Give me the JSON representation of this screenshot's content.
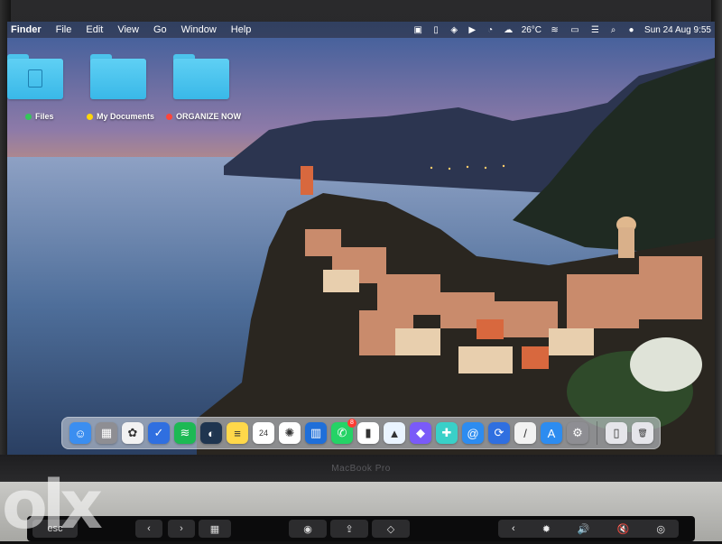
{
  "menubar": {
    "apple_icon": "apple-icon",
    "app_name": "Finder",
    "items": [
      "File",
      "Edit",
      "View",
      "Go",
      "Window",
      "Help"
    ],
    "status": {
      "weather": "26°C",
      "datetime": "Sun 24 Aug  9:55"
    }
  },
  "desktop": {
    "folders": [
      {
        "label": "Files",
        "tag_color": "#34c759",
        "icon": "folder-icon"
      },
      {
        "label": "My Documents",
        "tag_color": "#ffd60a",
        "icon": "folder-icon"
      },
      {
        "label": "ORGANIZE NOW",
        "tag_color": "#ff453a",
        "icon": "folder-icon"
      }
    ]
  },
  "dock": {
    "apps": [
      {
        "name": "finder-icon",
        "glyph": "☺",
        "color": "#3b8ef0"
      },
      {
        "name": "launchpad-icon",
        "glyph": "▦",
        "color": "#8e8e93"
      },
      {
        "name": "photos-icon",
        "glyph": "✿",
        "color": "#f2f2f2"
      },
      {
        "name": "reminders-icon",
        "glyph": "✓",
        "color": "#2f6fe0"
      },
      {
        "name": "spotify-icon",
        "glyph": "≋",
        "color": "#1db954"
      },
      {
        "name": "copilot-icon",
        "glyph": "◐",
        "color": "#1f3550"
      },
      {
        "name": "notes-icon",
        "glyph": "≡",
        "color": "#ffd84a"
      },
      {
        "name": "calendar-icon",
        "glyph": "24",
        "color": "#ffffff"
      },
      {
        "name": "chatgpt-icon",
        "glyph": "✺",
        "color": "#ffffff"
      },
      {
        "name": "trello-icon",
        "glyph": "▥",
        "color": "#1f6fd9"
      },
      {
        "name": "whatsapp-icon",
        "glyph": "✆",
        "color": "#25d366",
        "badge": "8"
      },
      {
        "name": "numbers-icon",
        "glyph": "▮",
        "color": "#ffffff"
      },
      {
        "name": "app-icon",
        "glyph": "▲",
        "color": "#eaf4ff"
      },
      {
        "name": "shortcuts-icon",
        "glyph": "◆",
        "color": "#7a5af8"
      },
      {
        "name": "colorful-app-icon",
        "glyph": "✚",
        "color": "#39d0c8"
      },
      {
        "name": "mail-icon",
        "glyph": "@",
        "color": "#2d8cf0"
      },
      {
        "name": "sync-app-icon",
        "glyph": "⟳",
        "color": "#2f6fe0"
      },
      {
        "name": "keynote-icon",
        "glyph": "/",
        "color": "#f2f2f2"
      },
      {
        "name": "app-store-icon",
        "glyph": "A",
        "color": "#2d8cf0"
      },
      {
        "name": "system-settings-icon",
        "glyph": "⚙",
        "color": "#8e8e93"
      }
    ],
    "right_items": [
      {
        "name": "iphone-mirroring-icon",
        "glyph": "▯",
        "color": "#e5e5ea"
      },
      {
        "name": "trash-icon",
        "glyph": "🗑",
        "color": "#e5e5ea"
      }
    ]
  },
  "laptop": {
    "model_label": "MacBook Pro",
    "escape_label": "esc"
  },
  "watermark": {
    "text": "olx"
  }
}
